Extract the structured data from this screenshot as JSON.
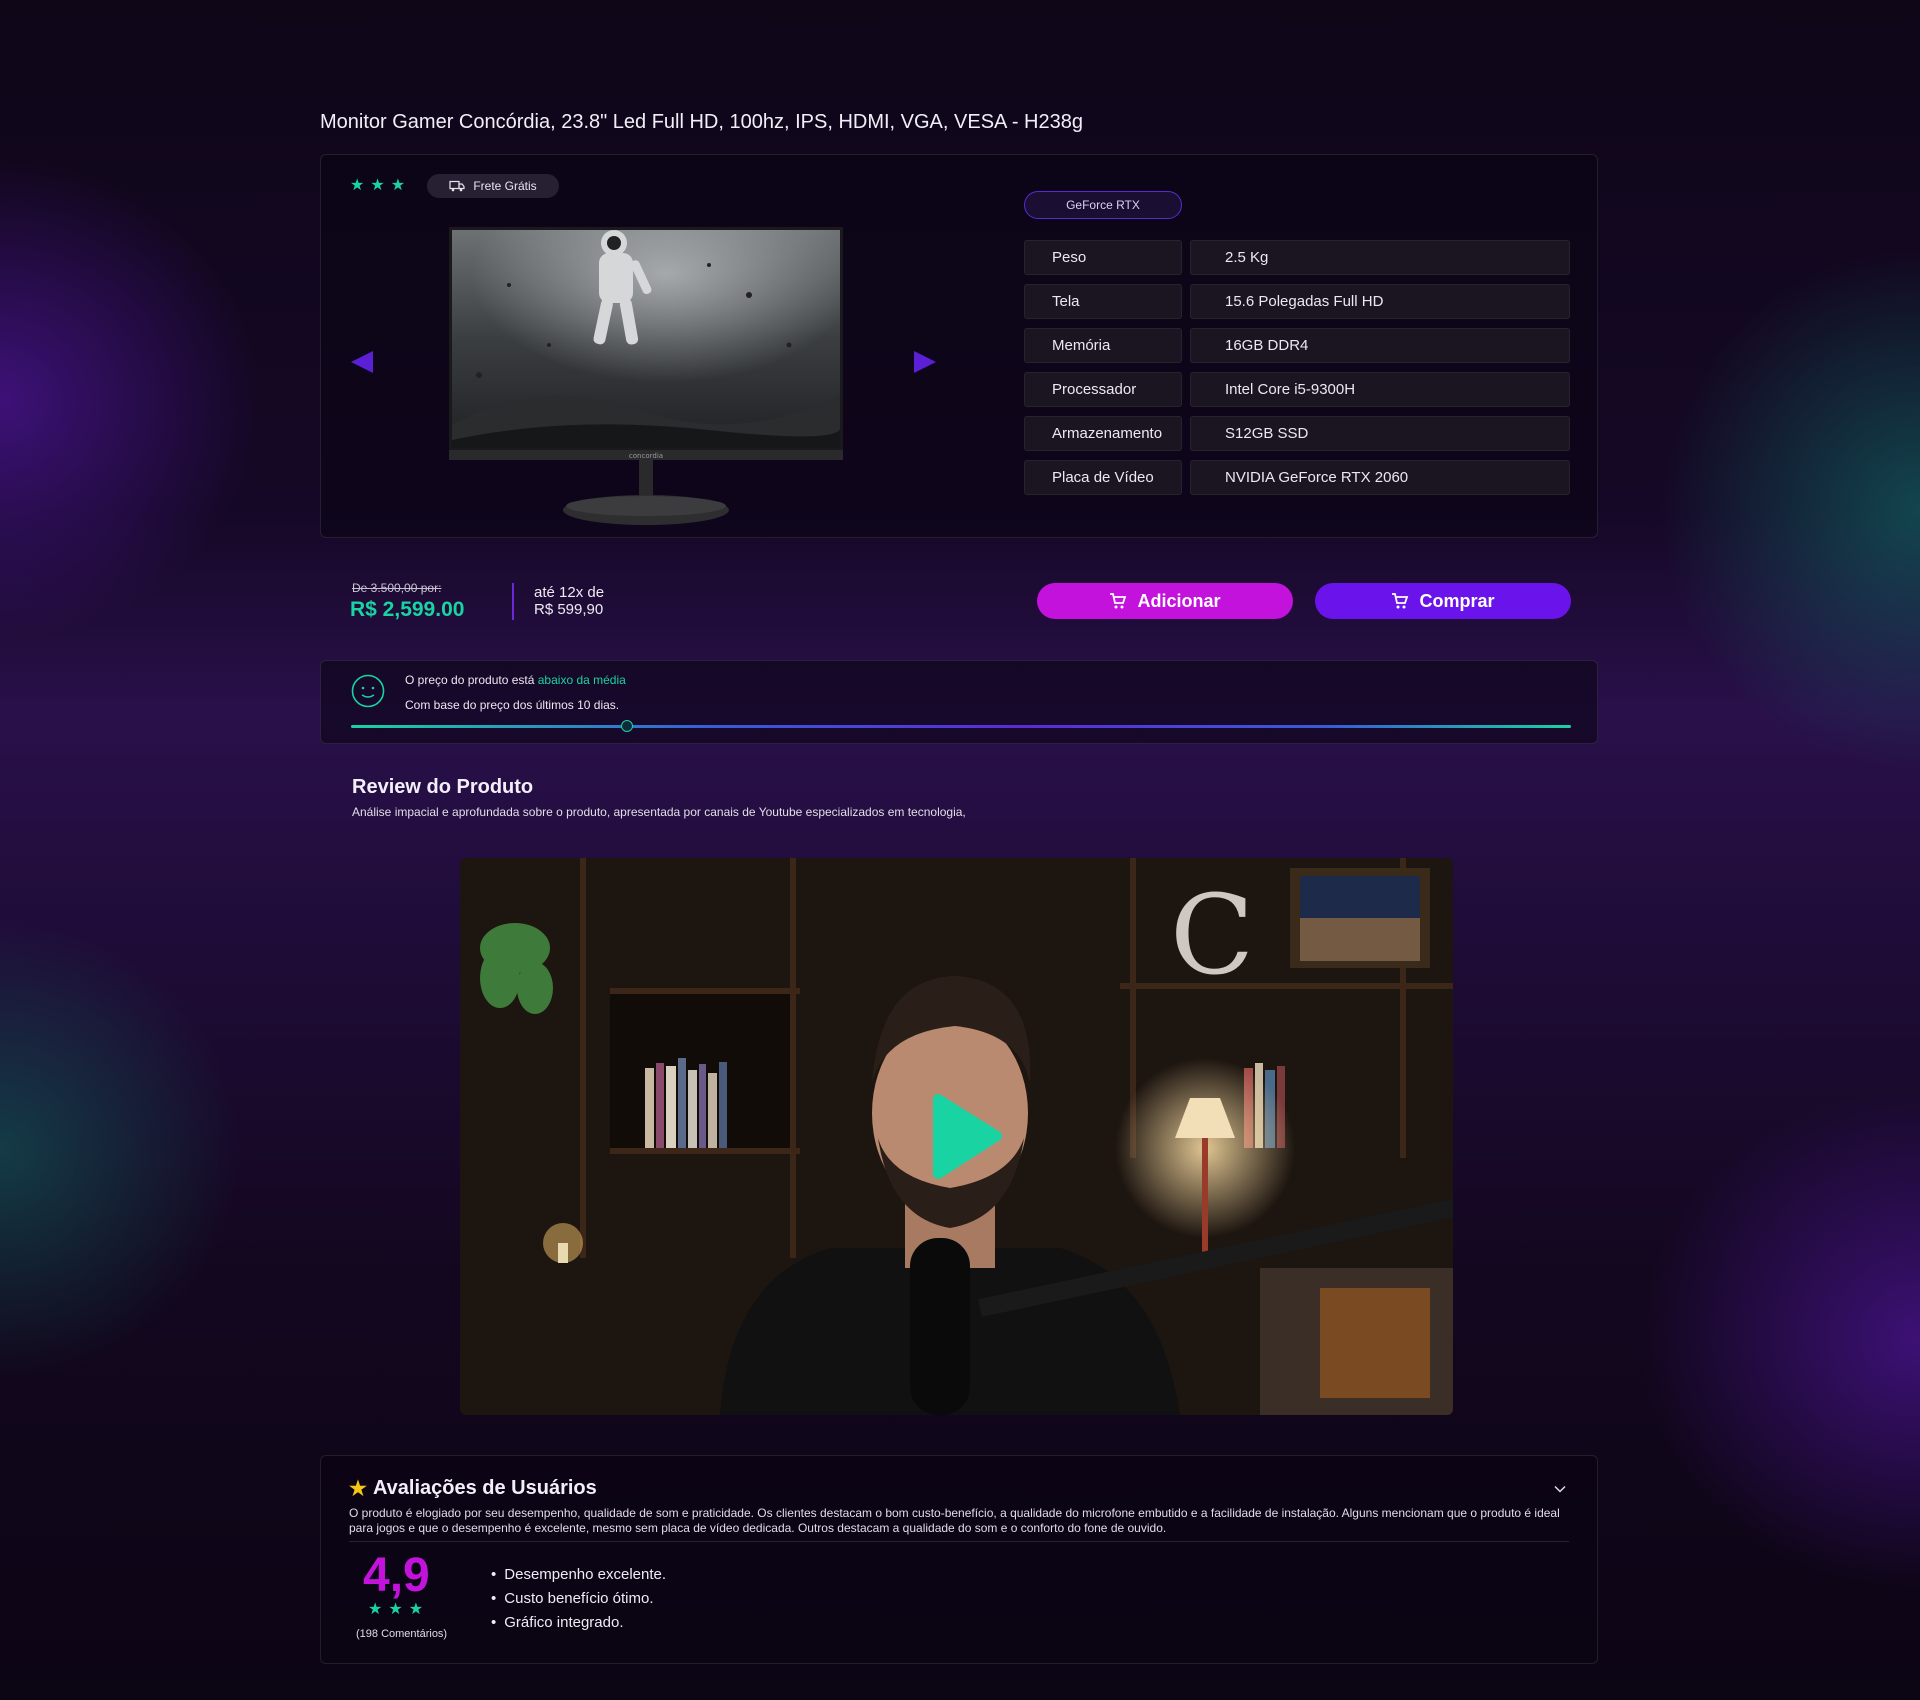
{
  "product": {
    "title": "Monitor Gamer Concórdia, 23.8\" Led Full HD, 100hz, IPS, HDMI, VGA, VESA - H238g",
    "rating_stars": 3,
    "shipping_badge": "Frete Grátis",
    "brand_on_monitor": "concordia",
    "tag": "GeForce RTX",
    "specs": [
      {
        "key": "Peso",
        "value": "2.5 Kg"
      },
      {
        "key": "Tela",
        "value": "15.6 Polegadas Full HD"
      },
      {
        "key": "Memória",
        "value": "16GB DDR4"
      },
      {
        "key": "Processador",
        "value": "Intel Core i5-9300H"
      },
      {
        "key": "Armazenamento",
        "value": "S12GB SSD"
      },
      {
        "key": "Placa de Vídeo",
        "value": "NVIDIA GeForce RTX 2060"
      }
    ]
  },
  "pricing": {
    "old_price": "De 3.500,00  por:",
    "price": "R$ 2,599.00",
    "installments_line1": "até 12x de",
    "installments_line2": "R$ 599,90",
    "add_label": "Adicionar",
    "buy_label": "Comprar"
  },
  "price_check": {
    "line1_prefix": "O preço do produto está ",
    "line1_highlight": "abaixo da média",
    "line2": "Com base do preço dos últimos 10 dias.",
    "position_fraction": 0.225
  },
  "review": {
    "title": "Review do Produto",
    "subtitle": "Análise impacial e aprofundada sobre o produto,  apresentada  por canais de Youtube especializados em tecnologia,"
  },
  "ratings": {
    "title": "Avaliações de Usuários",
    "description": "O produto é elogiado por seu desempenho, qualidade de som e praticidade. Os clientes destacam o bom custo-benefício, a qualidade do microfone embutido e a facilidade de instalação. Alguns mencionam que o produto é ideal para jogos e que o desempenho é excelente, mesmo sem placa de vídeo dedicada. Outros destacam a qualidade do som e o conforto do fone de ouvido.",
    "score": "4,9",
    "stars": 3,
    "count": "(198 Comentários)",
    "highlights": [
      "Desempenho excelente.",
      "Custo benefício ótimo.",
      "Gráfico integrado."
    ]
  },
  "colors": {
    "accent_green": "#19d3a2",
    "accent_magenta": "#c412dd",
    "accent_purple": "#6a13ea"
  }
}
